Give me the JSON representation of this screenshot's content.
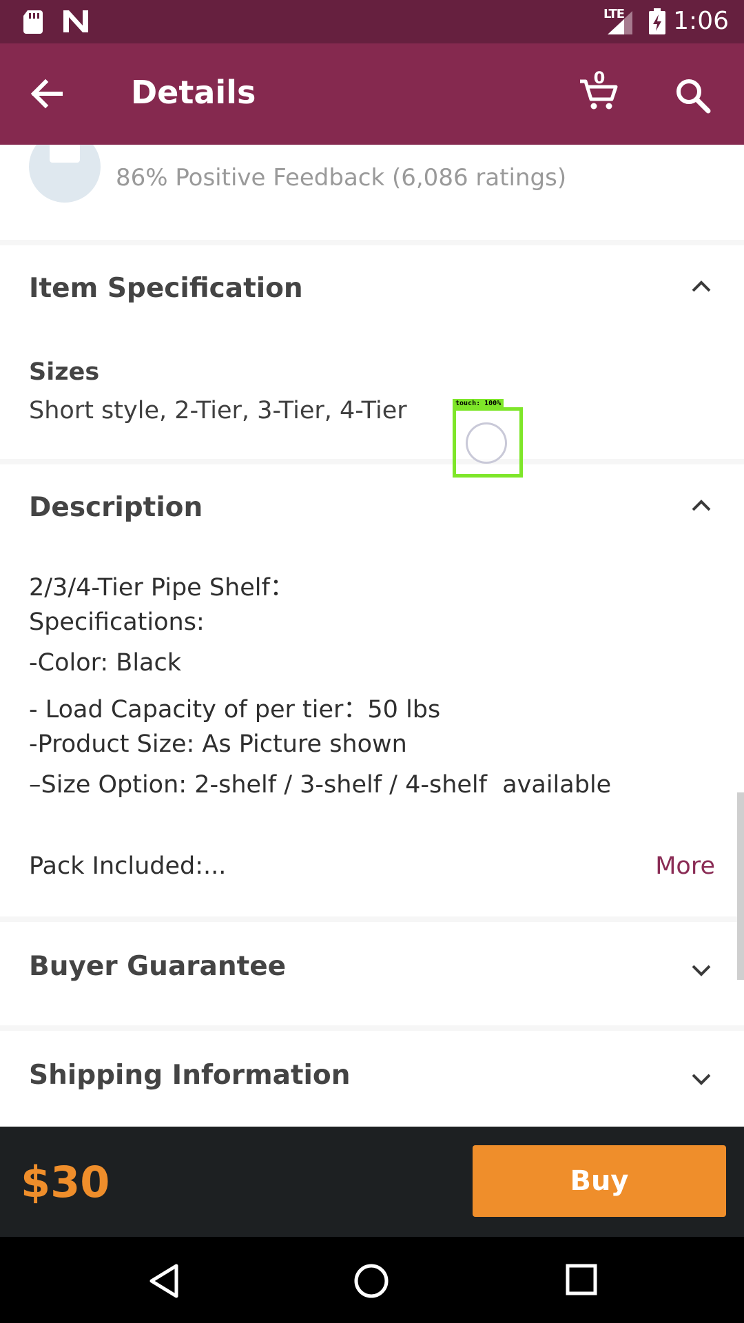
{
  "status_bar": {
    "network_label": "LTE",
    "time": "1:06"
  },
  "app_bar": {
    "title": "Details",
    "cart_count": "0"
  },
  "seller": {
    "feedback": "86% Positive Feedback (6,086 ratings)"
  },
  "item_specification": {
    "title": "Item Specification",
    "sizes_label": "Sizes",
    "sizes_value": "Short style, 2-Tier, 3-Tier, 4-Tier"
  },
  "description": {
    "title": "Description",
    "lines": [
      "2/3/4-Tier Pipe Shelf：",
      "Specifications:",
      "-Color: Black",
      "- Load Capacity of per tier：50 lbs",
      "-Product Size: As Picture shown",
      "–Size Option: 2-shelf / 3-shelf / 4-shelf  available",
      "Pack Included:..."
    ],
    "more_label": "More"
  },
  "buyer_guarantee": {
    "title": "Buyer Guarantee"
  },
  "shipping_information": {
    "title": "Shipping Information"
  },
  "touch_indicator": {
    "label": "touch: 100%"
  },
  "buy_bar": {
    "price": "$30",
    "buy_label": "Buy"
  },
  "colors": {
    "status_bar": "#66203f",
    "app_bar": "#85294f",
    "accent_orange": "#ef8e2b",
    "link": "#8a2c55",
    "buy_bar_bg": "#1d2022"
  }
}
